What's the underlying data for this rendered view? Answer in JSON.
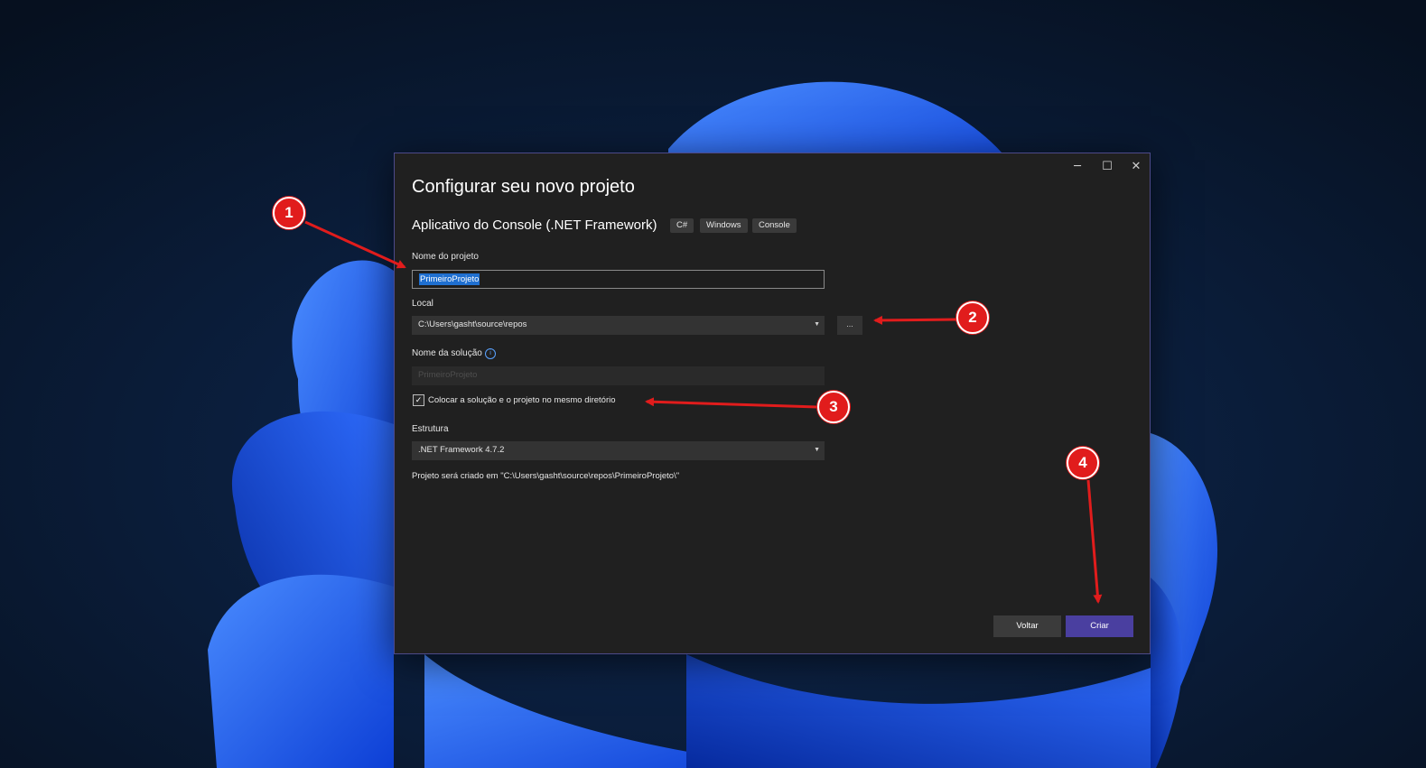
{
  "dialog": {
    "title": "Configurar seu novo projeto",
    "subtitle": "Aplicativo do Console (.NET Framework)",
    "tags": [
      "C#",
      "Windows",
      "Console"
    ],
    "window_controls": {
      "minimize": "─",
      "maximize": "☐",
      "close": "✕"
    }
  },
  "form": {
    "project_name_label": "Nome do projeto",
    "project_name_value": "PrimeiroProjeto",
    "location_label": "Local",
    "location_value": "C:\\Users\\gasht\\source\\repos",
    "browse_label": "...",
    "solution_name_label": "Nome da solução",
    "solution_name_value": "PrimeiroProjeto",
    "same_dir_label": "Colocar a solução e o projeto no mesmo diretório",
    "same_dir_checked": true,
    "framework_label": "Estrutura",
    "framework_value": ".NET Framework 4.7.2",
    "path_note": "Projeto será criado em \"C:\\Users\\gasht\\source\\repos\\PrimeiroProjeto\\\""
  },
  "buttons": {
    "back": "Voltar",
    "create": "Criar"
  },
  "annotations": {
    "badges": [
      "1",
      "2",
      "3",
      "4"
    ],
    "color": "#e11c1c"
  },
  "colors": {
    "dialog_bg": "#202020",
    "accent": "#4a3fa0",
    "selection": "#1f6fd0"
  }
}
